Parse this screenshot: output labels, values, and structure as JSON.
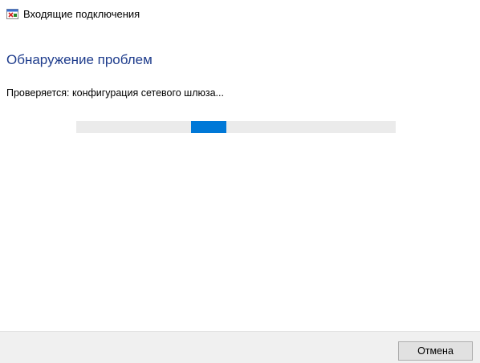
{
  "window": {
    "title": "Входящие подключения",
    "icon": "troubleshooter-icon"
  },
  "main": {
    "heading": "Обнаружение проблем",
    "status_text": "Проверяется: конфигурация сетевого шлюза...",
    "progress": {
      "mode": "indeterminate",
      "chunk_start_fraction": 0.36,
      "chunk_width_fraction": 0.11
    }
  },
  "footer": {
    "cancel_label": "Отмена"
  },
  "colors": {
    "heading": "#1e3c8c",
    "progress_fill": "#0078d7",
    "progress_track": "#ebebeb"
  }
}
